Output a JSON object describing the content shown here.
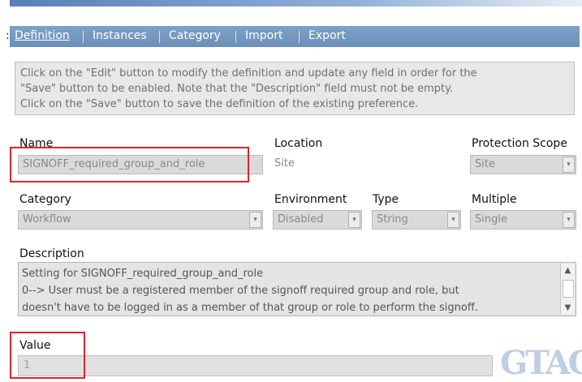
{
  "tabs": [
    "Definition",
    "Instances",
    "Category",
    "Import",
    "Export"
  ],
  "active_tab": "Definition",
  "info": {
    "line1": "Click on the \"Edit\" button to modify the definition and update any field in order for the",
    "line2": "\"Save\" button to be enabled. Note that the \"Description\" field must not be empty.",
    "line3": "Click on the \"Save\" button to save the definition of the existing preference."
  },
  "fields": {
    "name": {
      "label": "Name",
      "value": "SIGNOFF_required_group_and_role"
    },
    "location": {
      "label": "Location",
      "value": "Site"
    },
    "protection_scope": {
      "label": "Protection Scope",
      "value": "Site"
    },
    "category": {
      "label": "Category",
      "value": "Workflow"
    },
    "environment": {
      "label": "Environment",
      "value": "Disabled"
    },
    "type": {
      "label": "Type",
      "value": "String"
    },
    "multiple": {
      "label": "Multiple",
      "value": "Single"
    }
  },
  "description": {
    "label": "Description",
    "line1": "Setting for SIGNOFF_required_group_and_role",
    "line2": "0--> User must be a registered member of the signoff required group and role, but",
    "line3": "doesn't have to be logged in as a member of that group or role to perform the signoff."
  },
  "value": {
    "label": "Value",
    "value": "1"
  },
  "watermark": "GTAC",
  "colors": {
    "tab_bar": "#6b8fb8",
    "highlight_box": "#e0232b",
    "field_bg": "#dadada"
  },
  "icons": [
    "dropdown-arrow-icon",
    "scroll-up-icon",
    "scroll-down-icon"
  ]
}
